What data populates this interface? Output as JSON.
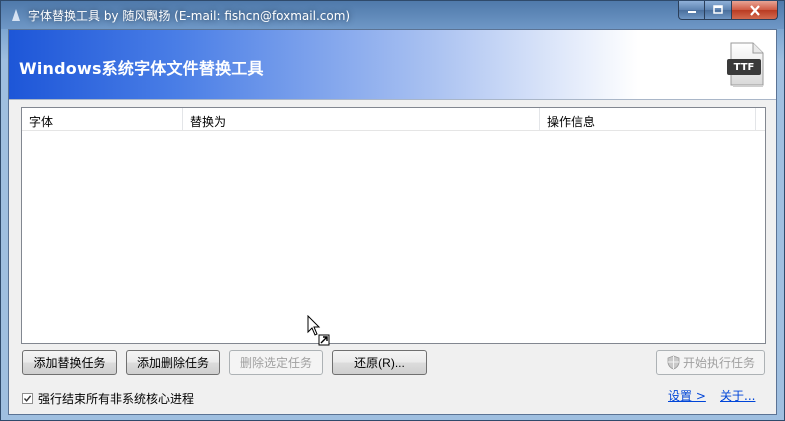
{
  "window": {
    "title": "字体替换工具 by 随风飘扬 (E-mail: fishcn@foxmail.com)"
  },
  "banner": {
    "title": "Windows系统字体文件替换工具",
    "file_badge": "TTF"
  },
  "table": {
    "columns": [
      "字体",
      "替换为",
      "操作信息",
      ""
    ],
    "rows": []
  },
  "buttons": {
    "add_replace": "添加替换任务",
    "add_delete": "添加删除任务",
    "delete_selected": "删除选定任务",
    "restore": "还原(R)...",
    "start": "开始执行任务"
  },
  "options": {
    "force_kill_label": "强行结束所有非系统核心进程",
    "force_kill_checked": true
  },
  "links": {
    "settings": "设置 >",
    "about": "关于..."
  },
  "colors": {
    "banner_start": "#1d56d8",
    "link": "#0045d8"
  }
}
